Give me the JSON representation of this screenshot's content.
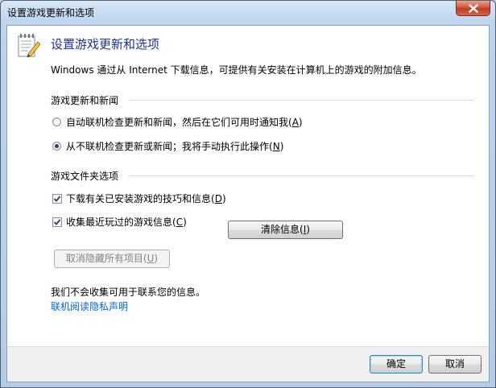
{
  "window": {
    "title": "设置游戏更新和选项"
  },
  "header": {
    "icon": "notepad-pencil-icon",
    "title": "设置游戏更新和选项",
    "description": "Windows 通过从 Internet 下载信息，可提供有关安装在计算机上的游戏的附加信息。"
  },
  "updates_group": {
    "label": "游戏更新和新闻",
    "options": [
      {
        "text": "自动联机检查更新和新闻，然后在它们可用时通知我",
        "key": "A",
        "selected": false
      },
      {
        "text": "从不联机检查更新或新闻；我将手动执行此操作",
        "key": "N",
        "selected": true
      }
    ]
  },
  "folder_group": {
    "label": "游戏文件夹选项",
    "checkboxes": [
      {
        "text": "下载有关已安装游戏的技巧和信息",
        "key": "D",
        "checked": true
      },
      {
        "text": "收集最近玩过的游戏信息",
        "key": "C",
        "checked": true
      }
    ],
    "clear_button": {
      "text": "清除信息",
      "key": "I"
    },
    "unhide_button": {
      "text": "取消隐藏所有项目",
      "key": "U"
    }
  },
  "privacy": {
    "note": "我们不会收集可用于联系您的信息。",
    "link": "联机阅读隐私声明"
  },
  "footer": {
    "ok": "确定",
    "cancel": "取消"
  },
  "colors": {
    "heading": "#1e3287",
    "link": "#0066cc",
    "close_button": "#c03a20"
  }
}
